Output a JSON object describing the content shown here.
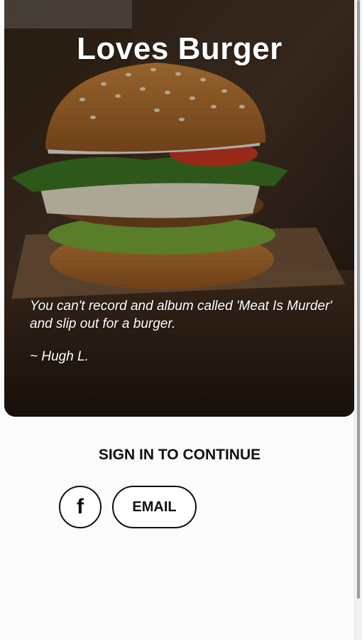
{
  "hero": {
    "title": "Loves Burger",
    "image": "burger-photo",
    "quote": "You can't record and album called 'Meat Is Murder' and slip out for a burger.",
    "author": "~ Hugh L."
  },
  "signin": {
    "heading": "SIGN IN TO CONTINUE",
    "facebook_icon": "facebook-icon",
    "facebook_glyph": "f",
    "email_label": "EMAIL"
  },
  "colors": {
    "text_dark": "#111111",
    "background": "#fbfbfb",
    "overlay_text": "#ffffff"
  }
}
